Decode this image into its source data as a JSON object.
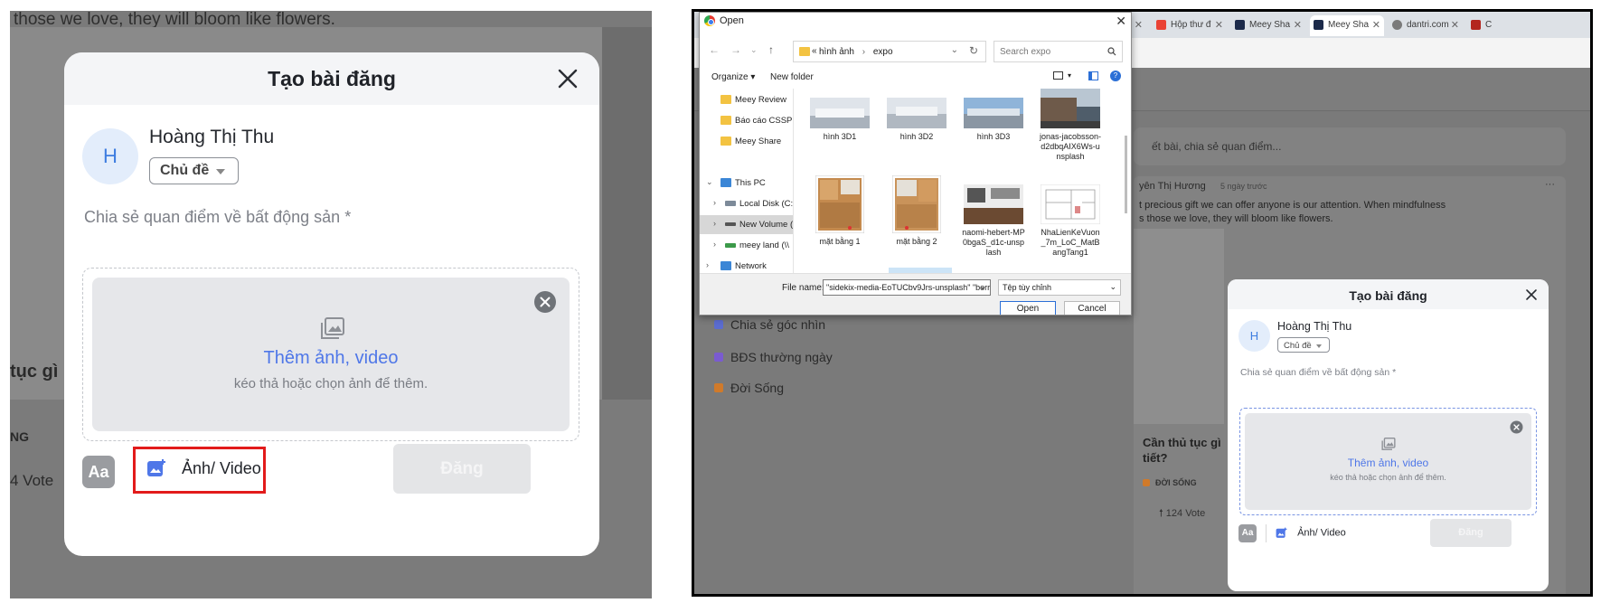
{
  "left": {
    "background": {
      "top_text": "those we love, they will bloom like flowers.",
      "side_heading": "tục gì",
      "side_tag": "NG",
      "side_votes": "4 Vote"
    },
    "dialog": {
      "title": "Tạo bài đăng",
      "avatar_initial": "H",
      "user_name": "Hoàng Thị Thu",
      "topic_label": "Chủ đề",
      "placeholder": "Chia sẻ quan điểm về bất động sản *",
      "drop_label": "Thêm ảnh, video",
      "drop_hint": "kéo thả hoặc chọn ảnh để thêm.",
      "format_label": "Aa",
      "media_label": "Ảnh/ Video",
      "post_label": "Đăng",
      "highlight_color": "#e21b1b"
    }
  },
  "right": {
    "tabs": [
      {
        "label": "",
        "icon": "tab-icon"
      },
      {
        "label": "Hộp thư đ",
        "icon": "gmail-icon"
      },
      {
        "label": "Meey Sha",
        "icon": "meey-icon"
      },
      {
        "label": "Meey Sha",
        "icon": "meey-icon"
      },
      {
        "label": "dantri.com",
        "icon": "globe-icon"
      },
      {
        "label": "C",
        "icon": "n-icon"
      }
    ],
    "app": {
      "compose_placeholder": "ết bài, chia sẻ quan điểm...",
      "sidebar": [
        {
          "label": "Chia sẻ góc nhìn",
          "color": "#5b6ccf"
        },
        {
          "label": "BĐS thường ngày",
          "color": "#7a5bd0"
        },
        {
          "label": "Đời Sống",
          "color": "#d07a2a"
        }
      ],
      "post": {
        "author": "yên Thị Hương",
        "time": "5 ngày trước",
        "more": "···",
        "text_line1": "t precious gift we can offer anyone is our attention. When mindfulness",
        "text_line2": "s those we love, they will bloom like flowers.",
        "question": "Cần thủ tục gì",
        "question2": "tiết?",
        "tag": "ĐỜI SỐNG",
        "votes": "124 Vote"
      }
    },
    "file_dialog": {
      "title": "Open",
      "path": [
        "hình ảnh",
        "expo"
      ],
      "path_prefix": "«",
      "search_placeholder": "Search expo",
      "organize": "Organize",
      "new_folder": "New folder",
      "sidebar": [
        {
          "label": "Meey Review",
          "type": "folder"
        },
        {
          "label": "Báo cáo CSSP",
          "type": "folder"
        },
        {
          "label": "Meey Share",
          "type": "folder"
        },
        {
          "label": "This PC",
          "type": "pc"
        },
        {
          "label": "Local Disk (C:)",
          "type": "disk"
        },
        {
          "label": "New Volume (",
          "type": "disk"
        },
        {
          "label": "meey land (\\\\",
          "type": "net"
        },
        {
          "label": "Network",
          "type": "network"
        }
      ],
      "files": [
        {
          "name": "hình 3D1",
          "kind": "pano"
        },
        {
          "name": "hình 3D2",
          "kind": "pano"
        },
        {
          "name": "hình 3D3",
          "kind": "pano"
        },
        {
          "name": "jonas-jacobsson-d2dbqAIX6Ws-unsplash",
          "kind": "street"
        },
        {
          "name": "mặt bằng 1",
          "kind": "plan"
        },
        {
          "name": "mặt bằng 2",
          "kind": "plan"
        },
        {
          "name": "naomi-hebert-MP0bgaS_d1c-unsplash",
          "kind": "kitchen"
        },
        {
          "name": "NhaLienKeVuon_7m_LoC_MatBangTang1",
          "kind": "drawing"
        }
      ],
      "filename_label": "File name:",
      "filename_value": "\"sidekix-media-EoTUCbv9Jrs-unsplash\" \"berr",
      "filetype_value": "Tệp tùy chỉnh",
      "open_label": "Open",
      "cancel_label": "Cancel"
    },
    "dialog": {
      "title": "Tạo bài đăng",
      "avatar_initial": "H",
      "user_name": "Hoàng Thị Thu",
      "topic_label": "Chủ đề",
      "placeholder": "Chia sẻ quan điểm về bất động sản *",
      "drop_label": "Thêm ảnh, video",
      "drop_hint": "kéo thả hoặc chọn ảnh để thêm.",
      "format_label": "Aa",
      "media_label": "Ảnh/ Video",
      "post_label": "Đăng"
    }
  }
}
